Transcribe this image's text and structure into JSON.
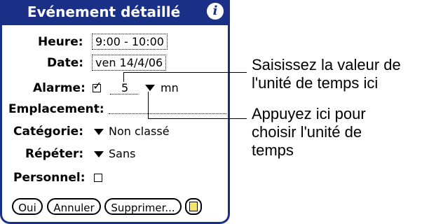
{
  "dialog": {
    "title": "Evénement détaillé",
    "info_icon": "i",
    "heure": {
      "label": "Heure:",
      "value": "9:00 - 10:00"
    },
    "date": {
      "label": "Date:",
      "value": "ven 14/4/06"
    },
    "alarme": {
      "label": "Alarme:",
      "checked": true,
      "check_glyph": "✓",
      "value": "5",
      "unit": "mn"
    },
    "emplacement": {
      "label": "Emplacement:",
      "value": ""
    },
    "categorie": {
      "label": "Catégorie:",
      "value": "Non classé"
    },
    "repeter": {
      "label": "Répéter:",
      "value": "Sans"
    },
    "personnel": {
      "label": "Personnel:",
      "checked": false
    },
    "buttons": {
      "oui": "Oui",
      "annuler": "Annuler",
      "supprimer": "Supprimer..."
    },
    "note_icon": "note-icon"
  },
  "callouts": {
    "top": [
      "Saisissez la valeur de",
      "l'unité de temps ici"
    ],
    "bottom": [
      "Appuyez ici pour",
      "choisir l'unité de",
      "temps"
    ]
  },
  "colors": {
    "title_bar": "#1a2f86",
    "note": "#f4e56a"
  }
}
